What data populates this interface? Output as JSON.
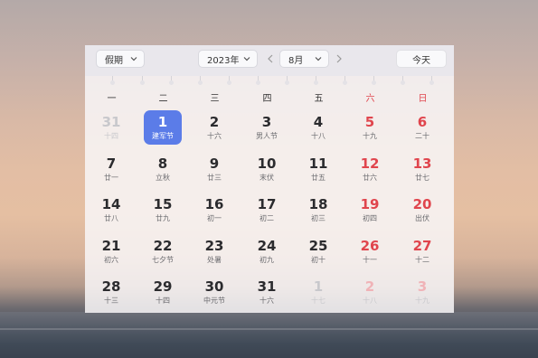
{
  "toolbar": {
    "holiday_select": "假期",
    "year_select": "2023年",
    "month_select": "8月",
    "today_button": "今天"
  },
  "weekdays": [
    "一",
    "二",
    "三",
    "四",
    "五",
    "六",
    "日"
  ],
  "weeks": [
    [
      {
        "day": "31",
        "sub": "十四",
        "faded": true
      },
      {
        "day": "1",
        "sub": "建军节",
        "selected": true
      },
      {
        "day": "2",
        "sub": "十六"
      },
      {
        "day": "3",
        "sub": "男人节"
      },
      {
        "day": "4",
        "sub": "十八"
      },
      {
        "day": "5",
        "sub": "十九"
      },
      {
        "day": "6",
        "sub": "二十"
      }
    ],
    [
      {
        "day": "7",
        "sub": "廿一"
      },
      {
        "day": "8",
        "sub": "立秋"
      },
      {
        "day": "9",
        "sub": "廿三"
      },
      {
        "day": "10",
        "sub": "末伏"
      },
      {
        "day": "11",
        "sub": "廿五"
      },
      {
        "day": "12",
        "sub": "廿六"
      },
      {
        "day": "13",
        "sub": "廿七"
      }
    ],
    [
      {
        "day": "14",
        "sub": "廿八"
      },
      {
        "day": "15",
        "sub": "廿九"
      },
      {
        "day": "16",
        "sub": "初一"
      },
      {
        "day": "17",
        "sub": "初二"
      },
      {
        "day": "18",
        "sub": "初三"
      },
      {
        "day": "19",
        "sub": "初四"
      },
      {
        "day": "20",
        "sub": "出伏"
      }
    ],
    [
      {
        "day": "21",
        "sub": "初六"
      },
      {
        "day": "22",
        "sub": "七夕节"
      },
      {
        "day": "23",
        "sub": "处暑"
      },
      {
        "day": "24",
        "sub": "初九"
      },
      {
        "day": "25",
        "sub": "初十"
      },
      {
        "day": "26",
        "sub": "十一"
      },
      {
        "day": "27",
        "sub": "十二"
      }
    ],
    [
      {
        "day": "28",
        "sub": "十三"
      },
      {
        "day": "29",
        "sub": "十四"
      },
      {
        "day": "30",
        "sub": "中元节"
      },
      {
        "day": "31",
        "sub": "十六"
      },
      {
        "day": "1",
        "sub": "十七",
        "faded": true
      },
      {
        "day": "2",
        "sub": "十八",
        "faded": true
      },
      {
        "day": "3",
        "sub": "十九",
        "faded": true
      }
    ]
  ],
  "colors": {
    "selected": "#5b7ce8",
    "weekend": "#e0454d"
  },
  "icons": {
    "prev": "chevron-left-icon",
    "next": "chevron-right-icon",
    "dropdown": "chevron-down-icon"
  }
}
